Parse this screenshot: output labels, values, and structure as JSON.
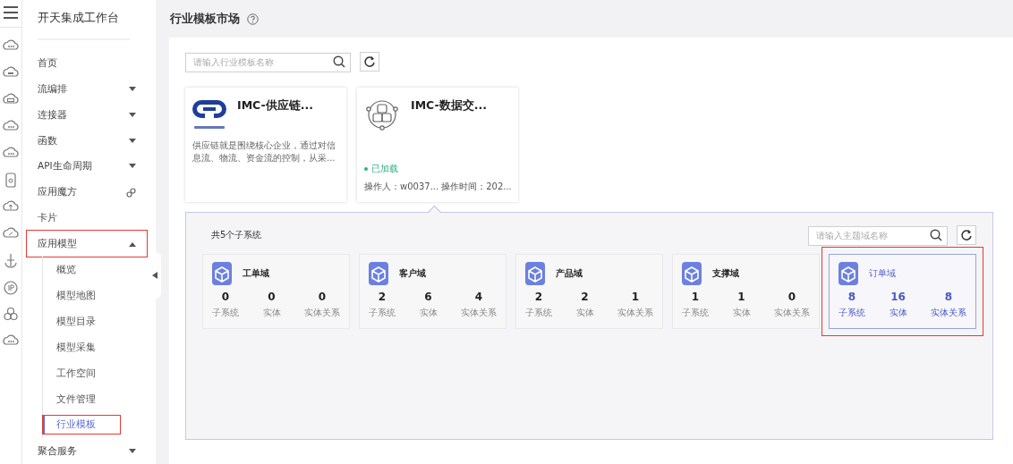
{
  "sidebar": {
    "title": "开天集成工作台",
    "items": [
      {
        "label": "首页",
        "kind": "plain",
        "highlighted": false
      },
      {
        "label": "流编排",
        "kind": "menu",
        "expanded": false,
        "highlighted": false
      },
      {
        "label": "连接器",
        "kind": "menu",
        "expanded": false,
        "highlighted": false
      },
      {
        "label": "函数",
        "kind": "menu",
        "expanded": false,
        "highlighted": false
      },
      {
        "label": "API生命周期",
        "kind": "menu",
        "expanded": false,
        "highlighted": false
      },
      {
        "label": "应用魔方",
        "kind": "link",
        "highlighted": false
      },
      {
        "label": "卡片",
        "kind": "plain",
        "highlighted": false
      },
      {
        "label": "应用模型",
        "kind": "menu",
        "expanded": true,
        "highlighted": true,
        "children": [
          {
            "label": "概览",
            "selected": false,
            "highlighted": false
          },
          {
            "label": "模型地图",
            "selected": false,
            "highlighted": false
          },
          {
            "label": "模型目录",
            "selected": false,
            "highlighted": false
          },
          {
            "label": "模型采集",
            "selected": false,
            "highlighted": false
          },
          {
            "label": "工作空间",
            "selected": false,
            "highlighted": false
          },
          {
            "label": "文件管理",
            "selected": false,
            "highlighted": false
          },
          {
            "label": "行业模板",
            "selected": true,
            "highlighted": true
          }
        ]
      },
      {
        "label": "聚合服务",
        "kind": "menu",
        "expanded": false,
        "highlighted": false
      }
    ]
  },
  "page": {
    "title": "行业模板市场",
    "search": {
      "placeholder": "请输入行业模板名称"
    },
    "templates": [
      {
        "kind": "chain",
        "name": "IMC-供应链...",
        "description": "供应链就是围绕核心企业，通过对信息流、物流、资金流的控制，从采...",
        "selected": false
      },
      {
        "kind": "data",
        "name": "IMC-数据交...",
        "status": "已加载",
        "operator": "操作人：w0037...",
        "time": "操作时间：202...",
        "selected": true
      }
    ],
    "subsystems": {
      "count_label": "共5个子系统",
      "search": {
        "placeholder": "请输入主题域名称"
      },
      "domains": [
        {
          "name": "工单域",
          "stats": [
            {
              "value": "0",
              "label": "子系统"
            },
            {
              "value": "0",
              "label": "实体"
            },
            {
              "value": "0",
              "label": "实体关系"
            }
          ],
          "selected": false,
          "highlighted": false
        },
        {
          "name": "客户域",
          "stats": [
            {
              "value": "2",
              "label": "子系统"
            },
            {
              "value": "6",
              "label": "实体"
            },
            {
              "value": "4",
              "label": "实体关系"
            }
          ],
          "selected": false,
          "highlighted": false
        },
        {
          "name": "产品域",
          "stats": [
            {
              "value": "2",
              "label": "子系统"
            },
            {
              "value": "2",
              "label": "实体"
            },
            {
              "value": "1",
              "label": "实体关系"
            }
          ],
          "selected": false,
          "highlighted": false
        },
        {
          "name": "支撑域",
          "stats": [
            {
              "value": "1",
              "label": "子系统"
            },
            {
              "value": "1",
              "label": "实体"
            },
            {
              "value": "0",
              "label": "实体关系"
            }
          ],
          "selected": false,
          "highlighted": false
        },
        {
          "name": "订单域",
          "stats": [
            {
              "value": "8",
              "label": "子系统"
            },
            {
              "value": "16",
              "label": "实体"
            },
            {
              "value": "8",
              "label": "实体关系"
            }
          ],
          "selected": true,
          "highlighted": true
        }
      ]
    }
  }
}
